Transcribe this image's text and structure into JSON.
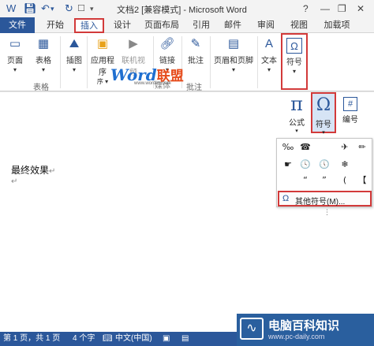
{
  "app": {
    "title": "文档2 [兼容模式] - Microsoft Word"
  },
  "window_controls": {
    "help": "?",
    "minimize": "—",
    "restore": "❐",
    "close": "✕"
  },
  "tabs": [
    "文件",
    "开始",
    "插入",
    "设计",
    "页面布局",
    "引用",
    "邮件",
    "审阅",
    "视图",
    "加载项"
  ],
  "ribbon": {
    "page": "页面",
    "table": "表格",
    "picture": "插图",
    "apps": "应用程序",
    "online_video": "联机视频",
    "link": "链接",
    "comment": "批注",
    "header_footer": "页眉和页脚",
    "text": "文本",
    "symbol": "符号",
    "groups": {
      "table": "表格",
      "media": "媒体",
      "comments": "批注"
    }
  },
  "watermark": {
    "word": "Word",
    "union": "联盟",
    "url": "www.wordlm.com"
  },
  "symbol_panel": {
    "formula": "公式",
    "symbol": "符号",
    "number": "编号"
  },
  "symbol_grid": [
    "‰",
    "☎",
    "",
    "✈",
    "✏",
    "☛",
    "🕓",
    "🕔",
    "❄",
    "",
    "",
    "",
    "",
    "",
    "",
    "“",
    "”",
    "❀",
    "(",
    "《",
    "【"
  ],
  "more_symbols": "其他符号(M)...",
  "doc": {
    "text": "最终效果"
  },
  "status": {
    "page": "第 1 页，共 1 页",
    "words": "4 个字",
    "lang": "中文(中国)"
  },
  "site_logo": {
    "name": "电脑百科知识",
    "url": "www.pc-daily.com"
  }
}
